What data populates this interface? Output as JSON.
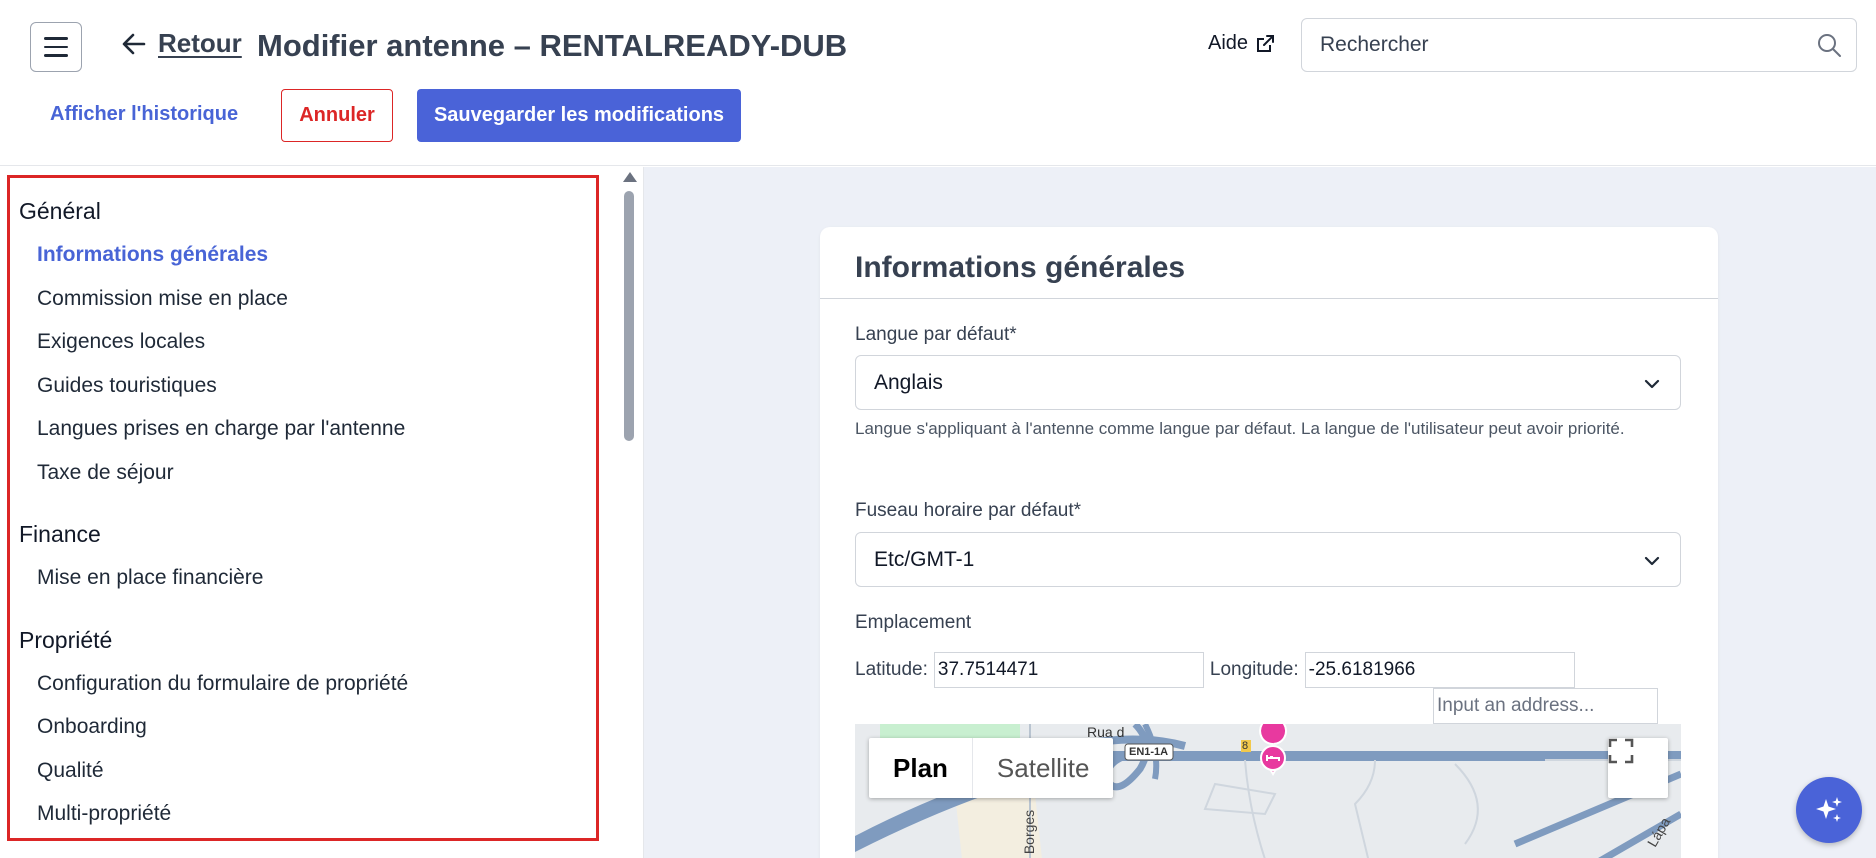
{
  "header": {
    "back_label": "Retour",
    "title": "Modifier antenne – RENTALREADY-DUB",
    "help_label": "Aide",
    "search_placeholder": "Rechercher",
    "history_link": "Afficher l'historique",
    "cancel_label": "Annuler",
    "save_label": "Sauvegarder les modifications"
  },
  "sidebar": {
    "groups": [
      {
        "title": "Général",
        "items": [
          {
            "label": "Informations générales",
            "active": true
          },
          {
            "label": "Commission mise en place"
          },
          {
            "label": "Exigences locales"
          },
          {
            "label": "Guides touristiques"
          },
          {
            "label": "Langues prises en charge par l'antenne"
          },
          {
            "label": "Taxe de séjour"
          }
        ]
      },
      {
        "title": "Finance",
        "items": [
          {
            "label": "Mise en place financière"
          }
        ]
      },
      {
        "title": "Propriété",
        "items": [
          {
            "label": "Configuration du formulaire de propriété"
          },
          {
            "label": "Onboarding"
          },
          {
            "label": "Qualité"
          },
          {
            "label": "Multi-propriété"
          }
        ]
      }
    ]
  },
  "form": {
    "section_title": "Informations générales",
    "language": {
      "label": "Langue par défaut*",
      "value": "Anglais",
      "help": "Langue s'appliquant à l'antenne comme langue par défaut. La langue de l'utilisateur peut avoir priorité."
    },
    "timezone": {
      "label": "Fuseau horaire par défaut*",
      "value": "Etc/GMT-1"
    },
    "location": {
      "label": "Emplacement",
      "latitude_label": "Latitude:",
      "latitude": "37.7514471",
      "longitude_label": "Longitude:",
      "longitude": "-25.6181966",
      "address_placeholder": "Input an address..."
    },
    "map": {
      "plan_label": "Plan",
      "satellite_label": "Satellite",
      "road_labels": [
        "EN1-1A",
        "8",
        "Rua d",
        "Borges",
        "Lápa"
      ]
    }
  },
  "colors": {
    "accent": "#4a63d8",
    "danger": "#dc2626",
    "main_bg": "#edf0f7",
    "marker": "#e8399f"
  }
}
